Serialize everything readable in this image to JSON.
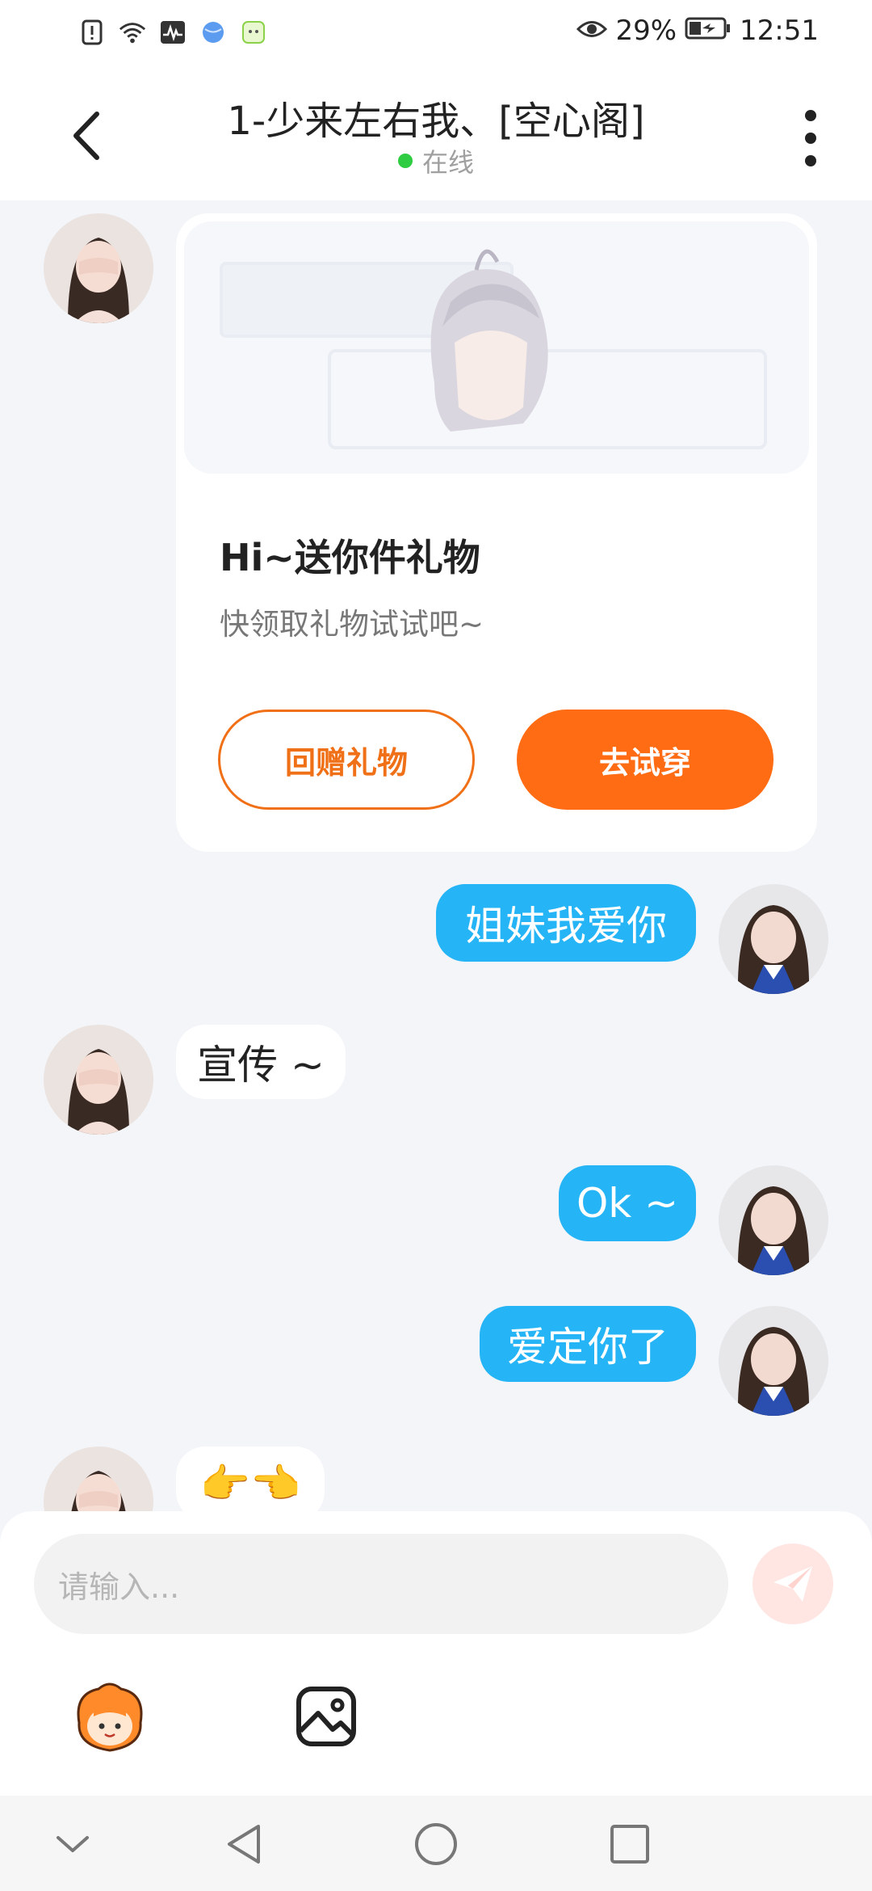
{
  "status_bar": {
    "battery_percent": "29%",
    "time": "12:51",
    "icons": [
      "notification-alert-icon",
      "wifi-icon",
      "activity-icon",
      "browser-icon",
      "app-icon",
      "eye-icon",
      "battery-icon"
    ]
  },
  "header": {
    "title": "1-少来左右我、[空心阁]",
    "status": "在线",
    "status_color": "#2ecc40"
  },
  "gift_card": {
    "title": "Hi~送你件礼物",
    "subtitle": "快领取礼物试试吧~",
    "return_gift_label": "回赠礼物",
    "try_on_label": "去试穿",
    "accent": "#ff6c14"
  },
  "messages": [
    {
      "side": "right",
      "text": "姐妹我爱你"
    },
    {
      "side": "left",
      "text": "宣传 ~"
    },
    {
      "side": "right",
      "text": "Ok ~"
    },
    {
      "side": "right",
      "text": "爱定你了"
    },
    {
      "side": "left",
      "text": "👉👈"
    }
  ],
  "input_bar": {
    "placeholder": "请输入..."
  },
  "colors": {
    "outgoing_bubble": "#25b4f5",
    "incoming_bubble": "#ffffff",
    "chat_background": "#f3f5f9"
  }
}
